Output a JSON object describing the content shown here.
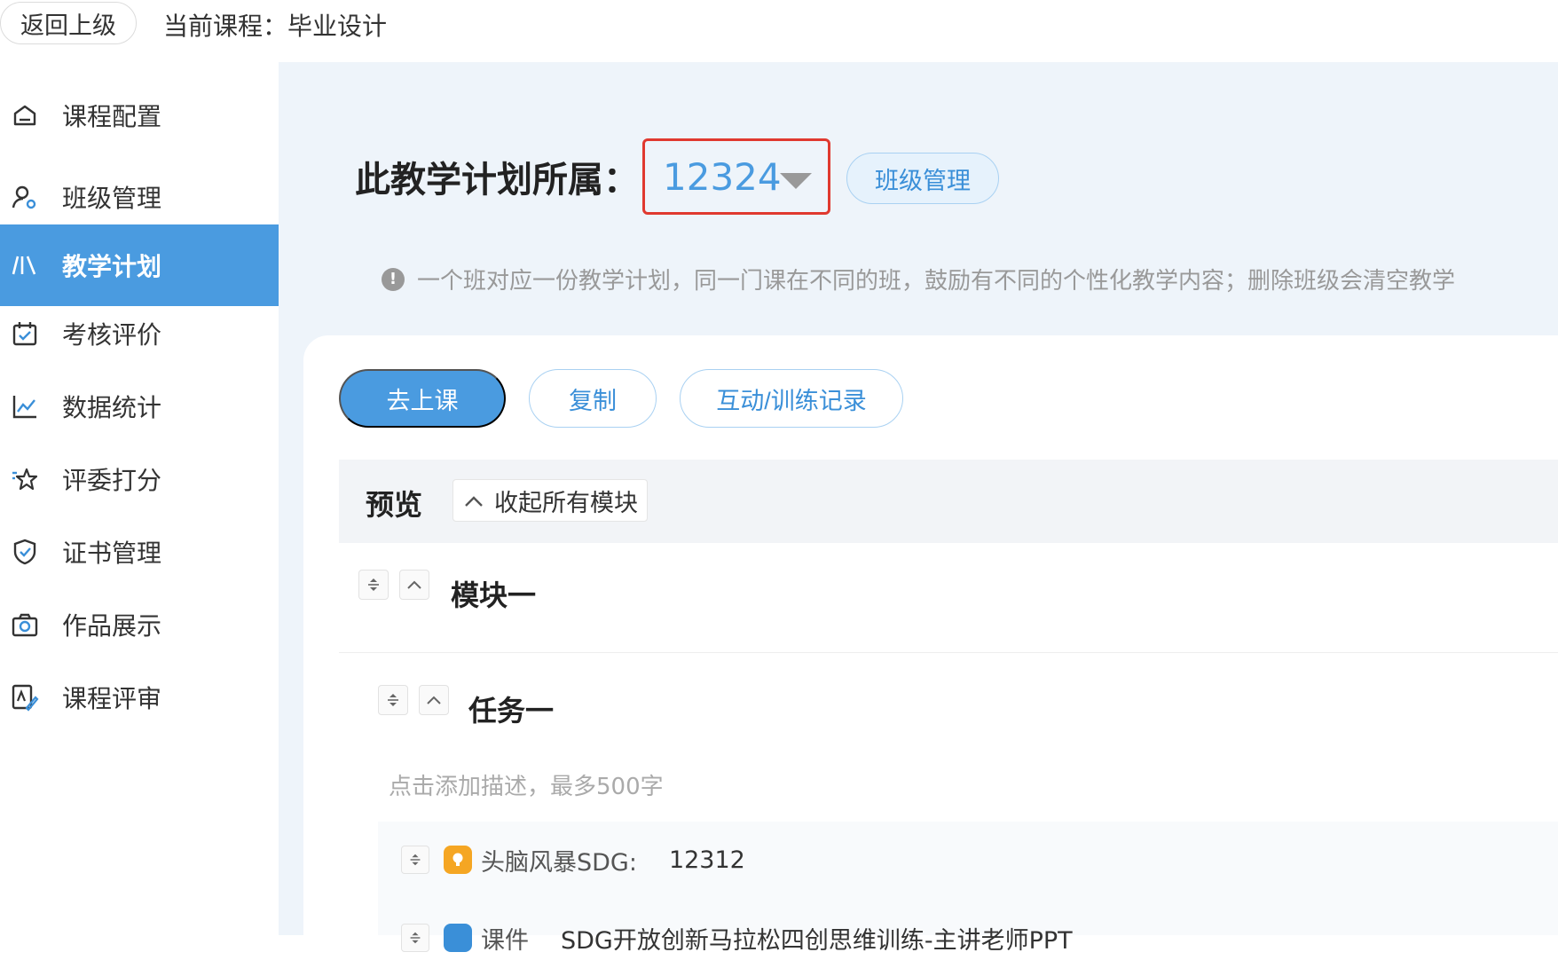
{
  "topbar": {
    "back_label": "返回上级",
    "course_label": "当前课程：毕业设计"
  },
  "sidebar": {
    "items": [
      {
        "label": "课程配置",
        "icon": "home-icon",
        "active": false
      },
      {
        "label": "班级管理",
        "icon": "user-settings-icon",
        "active": false
      },
      {
        "label": "教学计划",
        "icon": "plan-icon",
        "active": true
      },
      {
        "label": "考核评价",
        "icon": "calendar-check-icon",
        "active": false
      },
      {
        "label": "数据统计",
        "icon": "line-chart-icon",
        "active": false
      },
      {
        "label": "评委打分",
        "icon": "star-icon",
        "active": false
      },
      {
        "label": "证书管理",
        "icon": "shield-check-icon",
        "active": false
      },
      {
        "label": "作品展示",
        "icon": "camera-icon",
        "active": false
      },
      {
        "label": "课程评审",
        "icon": "review-edit-icon",
        "active": false
      }
    ]
  },
  "main": {
    "plan_title": "此教学计划所属：",
    "class_select_value": "12324",
    "class_mgmt_label": "班级管理",
    "tip_text": "一个班对应一份教学计划，同一门课在不同的班，鼓励有不同的个性化教学内容；删除班级会清空教学",
    "buttons": {
      "go_class": "去上课",
      "copy": "复制",
      "records": "互动/训练记录"
    },
    "preview": {
      "title": "预览",
      "collapse_all": "收起所有模块"
    },
    "module": {
      "title": "模块一"
    },
    "task": {
      "title": "任务一",
      "desc_placeholder": "点击添加描述，最多500字"
    },
    "items": [
      {
        "label": "头脑风暴SDG:",
        "value": "12312",
        "icon": "lightbulb-icon",
        "color": "#f5a623"
      },
      {
        "label": "课件",
        "value": "SDG开放创新马拉松四创思维训练-主讲老师PPT",
        "icon": "courseware-icon",
        "color": "#3a8fd8"
      }
    ]
  },
  "colors": {
    "accent": "#4a9be0",
    "highlight_border": "#e0392f"
  }
}
